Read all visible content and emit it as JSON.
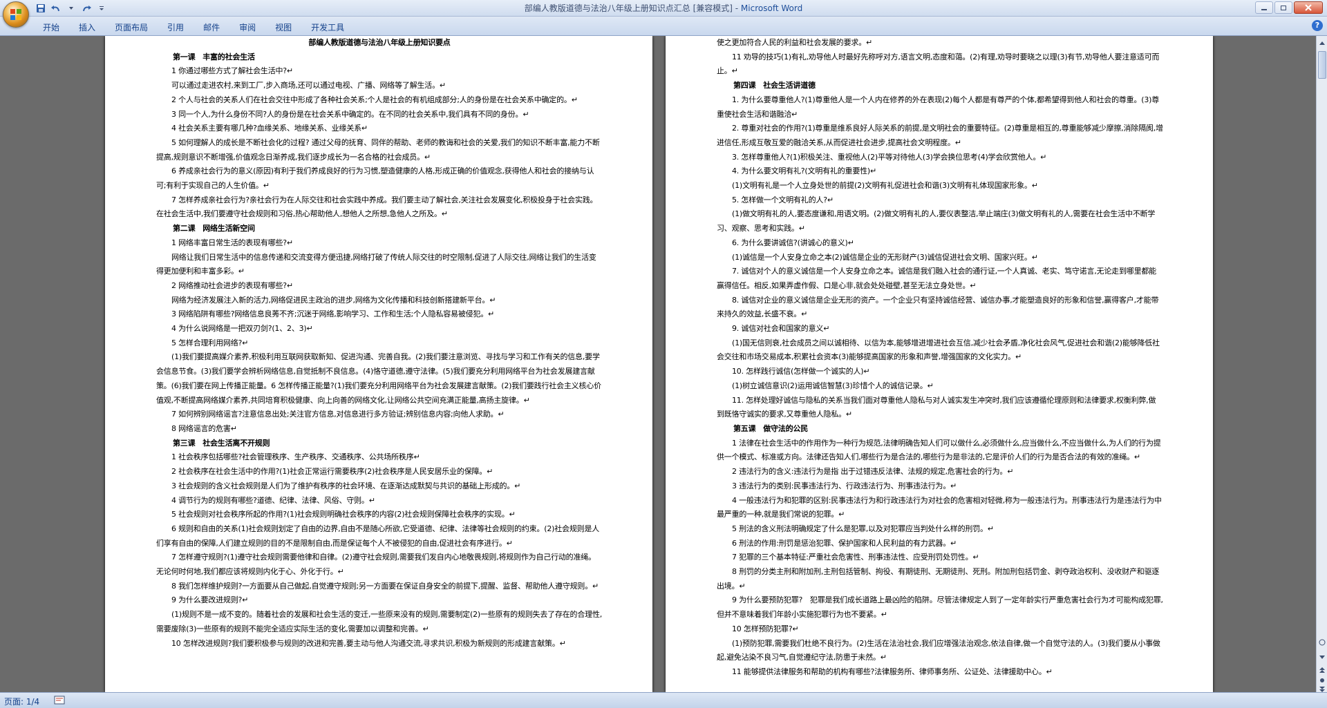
{
  "window": {
    "title_doc": "部编人教版道德与法治八年级上册知识点汇总 [兼容模式] - ",
    "title_app": "Microsoft Word"
  },
  "ribbon": {
    "tabs": [
      "开始",
      "插入",
      "页面布局",
      "引用",
      "邮件",
      "审阅",
      "视图",
      "开发工具"
    ]
  },
  "status": {
    "page": "页面: 1/4"
  },
  "icons": {
    "office": "office-logo-icon",
    "save": "save-icon",
    "undo": "undo-icon",
    "redo": "redo-icon"
  },
  "page1": {
    "lines": [
      {
        "s": "t",
        "text": "部编人教版道德与法治八年级上册知识要点"
      },
      {
        "s": "h",
        "text": "第一课　丰富的社会生活"
      },
      {
        "s": "i",
        "text": "1 你通过哪些方式了解社会生活中?↵"
      },
      {
        "s": "i",
        "text": "可以通过走进农村,来到工厂,步入商场,还可以通过电视、广播、网络等了解生活。↵"
      },
      {
        "s": "i",
        "text": "2 个人与社会的关系人们在社会交往中形成了各种社会关系;个人是社会的有机组成部分;人的身份是在社会关系中确定的。↵"
      },
      {
        "s": "i",
        "text": "3 同一个人,为什么身份不同?人的身份是在社会关系中确定的。在不同的社会关系中,我们具有不同的身份。↵"
      },
      {
        "s": "i",
        "text": "4 社会关系主要有哪几种?血缘关系、地缘关系、业缘关系↵"
      },
      {
        "s": "i",
        "text": "5 如何理解人的成长是不断社会化的过程? 通过父母的抚育、同伴的帮助、老师的教诲和社会的关爱,我们的知识不断丰富,能力不断提高,规则意识不断增强,价值观念日渐养成,我们逐步成长为一名合格的社会成员。↵"
      },
      {
        "s": "i",
        "text": "6 养成亲社会行为的意义(原因)有利于我们养成良好的行为习惯,塑造健康的人格,形成正确的价值观念,获得他人和社会的接纳与认可;有利于实现自己的人生价值。↵"
      },
      {
        "s": "i",
        "text": "7 怎样养成亲社会行为?亲社会行为在人际交往和社会实践中养成。我们要主动了解社会,关注社会发展变化,积极投身于社会实践。在社会生活中,我们要遵守社会规则和习俗,热心帮助他人,想他人之所想,急他人之所及。↵"
      },
      {
        "s": "h",
        "text": "第二课　网络生活新空间"
      },
      {
        "s": "i",
        "text": "1 网络丰富日常生活的表现有哪些?↵"
      },
      {
        "s": "i",
        "text": "网络让我们日常生活中的信息传递和交流变得方便迅捷,网络打破了传统人际交往的时空限制,促进了人际交往,网络让我们的生活变得更加便利和丰富多彩。↵"
      },
      {
        "s": "i",
        "text": "2 网络推动社会进步的表现有哪些?↵"
      },
      {
        "s": "i",
        "text": "网络为经济发展注入新的活力,网络促进民主政治的进步,网络为文化传播和科技创新搭建新平台。↵"
      },
      {
        "s": "i",
        "text": "3 网络陷阱有哪些?网络信息良莠不齐;沉迷于网络,影响学习、工作和生活;个人隐私容易被侵犯。↵"
      },
      {
        "s": "i",
        "text": "4 为什么说网络是一把双刃剑?(1、2、3)↵"
      },
      {
        "s": "i",
        "text": "5 怎样合理利用网络?↵"
      },
      {
        "s": "i",
        "text": "(1)我们要提高媒介素养,积极利用互联网获取新知、促进沟通、完善自我。(2)我们要注意浏览、寻找与学习和工作有关的信息,要学会信息节食。(3)我们要学会辨析网络信息,自觉抵制不良信息。(4)恪守道德,遵守法律。(5)我们要充分利用网络平台为社会发展建言献策。(6)我们要在网上传播正能量。6 怎样传播正能量?(1)我们要充分利用网络平台为社会发展建言献策。(2)我们要践行社会主义核心价值观,不断提高网络媒介素养,共同培育积极健康、向上向善的网络文化,让网络公共空间充满正能量,高扬主旋律。↵"
      },
      {
        "s": "i",
        "text": "7 如何辨别网络谣言?注意信息出处;关注官方信息,对信息进行多方验证;辨别信息内容;向他人求助。↵"
      },
      {
        "s": "i",
        "text": "8 网络谣言的危害↵"
      },
      {
        "s": "h",
        "text": "第三课　社会生活离不开规则"
      },
      {
        "s": "i",
        "text": "1 社会秩序包括哪些?社会管理秩序、生产秩序、交通秩序、公共场所秩序↵"
      },
      {
        "s": "i",
        "text": "2 社会秩序在社会生活中的作用?(1)社会正常运行需要秩序(2)社会秩序是人民安居乐业的保障。↵"
      },
      {
        "s": "i",
        "text": "3 社会规则的含义社会规则是人们为了维护有秩序的社会环境、在逐渐达成默契与共识的基础上形成的。↵"
      },
      {
        "s": "i",
        "text": "4 调节行为的规则有哪些?道德、纪律、法律、风俗、守则。↵"
      },
      {
        "s": "i",
        "text": "5 社会规则对社会秩序所起的作用?(1)社会规则明确社会秩序的内容(2)社会规则保障社会秩序的实现。↵"
      },
      {
        "s": "i",
        "text": "6 规则和自由的关系(1)社会规则划定了自由的边界,自由不是随心所欲,它受道德、纪律、法律等社会规则的约束。(2)社会规则是人们享有自由的保障,人们建立规则的目的不是限制自由,而是保证每个人不被侵犯的自由,促进社会有序进行。↵"
      },
      {
        "s": "i",
        "text": "7 怎样遵守规则?(1)遵守社会规则需要他律和自律。(2)遵守社会规则,需要我们发自内心地敬畏规则,将规则作为自己行动的准绳。无论何时何地,我们都应该将规则内化于心、外化于行。↵"
      },
      {
        "s": "i",
        "text": "8 我们怎样维护规则?一方面要从自己做起,自觉遵守规则;另一方面要在保证自身安全的前提下,提醒、监督、帮助他人遵守规则。↵"
      },
      {
        "s": "i",
        "text": "9 为什么要改进规则?↵"
      },
      {
        "s": "i",
        "text": "(1)规则不是一成不变的。随着社会的发展和社会生活的变迁,一些原来没有的规则,需要制定(2)一些原有的规则失去了存在的合理性,需要废除(3)一些原有的规则不能完全适应实际生活的变化,需要加以调整和完善。↵"
      },
      {
        "s": "i",
        "text": "10 怎样改进规则?我们要积极参与规则的改进和完善,要主动与他人沟通交流,寻求共识,积极为新规则的形成建言献策。↵"
      }
    ]
  },
  "page2": {
    "lines": [
      {
        "s": "p",
        "text": "使之更加符合人民的利益和社会发展的要求。↵"
      },
      {
        "s": "i",
        "text": "11 劝导的技巧(1)有礼,劝导他人时最好先称呼对方,语言文明,态度和蔼。(2)有理,劝导时要晓之以理(3)有节,劝导他人要注意适可而止。↵"
      },
      {
        "s": "h",
        "text": "第四课　社会生活讲道德"
      },
      {
        "s": "i",
        "text": "1. 为什么要尊重他人?(1)尊重他人是一个人内在修养的外在表现(2)每个人都是有尊严的个体,都希望得到他人和社会的尊重。(3)尊重使社会生活和谐融洽↵"
      },
      {
        "s": "i",
        "text": "2. 尊重对社会的作用?(1)尊重是维系良好人际关系的前提,是文明社会的重要特征。(2)尊重是相互的,尊重能够减少摩擦,消除隔阂,增进信任,形成互敬互爱的融洽关系,从而促进社会进步,提高社会文明程度。↵"
      },
      {
        "s": "i",
        "text": "3. 怎样尊重他人?(1)积极关注、重视他人(2)平等对待他人(3)学会换位思考(4)学会欣赏他人。↵"
      },
      {
        "s": "i",
        "text": "4. 为什么要文明有礼?(文明有礼的重要性)↵"
      },
      {
        "s": "i",
        "text": "(1)文明有礼是一个人立身处世的前提(2)文明有礼促进社会和谐(3)文明有礼体现国家形象。↵"
      },
      {
        "s": "i",
        "text": "5. 怎样做一个文明有礼的人?↵"
      },
      {
        "s": "i",
        "text": "(1)做文明有礼的人,要态度谦和,用语文明。(2)做文明有礼的人,要仪表整洁,举止端庄(3)做文明有礼的人,需要在社会生活中不断学习、观察、思考和实践。↵"
      },
      {
        "s": "i",
        "text": "6. 为什么要讲诚信?(讲诚心的意义)↵"
      },
      {
        "s": "i",
        "text": "(1)诚信是一个人安身立命之本(2)诚信是企业的无形财产(3)诚信促进社会文明、国家兴旺。↵"
      },
      {
        "s": "i",
        "text": "7. 诚信对个人的意义诚信是一个人安身立命之本。诚信是我们融入社会的通行证,一个人真诚、老实、笃守诺言,无论走到哪里都能赢得信任。相反,如果弄虚作假、口是心非,就会处处碰壁,甚至无法立身处世。↵"
      },
      {
        "s": "i",
        "text": "8. 诚信对企业的意义诚信是企业无形的资产。一个企业只有坚持诚信经营、诚信办事,才能塑造良好的形象和信誉,赢得客户,才能带来持久的效益,长盛不衰。↵"
      },
      {
        "s": "i",
        "text": "9. 诚信对社会和国家的意义↵"
      },
      {
        "s": "i",
        "text": "(1)国无信则衰,社会成员之间以诚相待、以信为本,能够增进增进社会互信,减少社会矛盾,净化社会风气,促进社会和谐(2)能够降低社会交往和市场交易成本,积累社会资本(3)能够提高国家的形象和声誉,增强国家的文化实力。↵"
      },
      {
        "s": "i",
        "text": "10. 怎样践行诚信(怎样做一个诚实的人)↵"
      },
      {
        "s": "i",
        "text": "(1)树立诚信意识(2)运用诚信智慧(3)珍惜个人的诚信记录。↵"
      },
      {
        "s": "i",
        "text": "11. 怎样处理好诚信与隐私的关系当我们面对尊重他人隐私与对人诚实发生冲突时,我们应该遵循伦理原则和法律要求,权衡利弊,做到既恪守诚实的要求,又尊重他人隐私。↵"
      },
      {
        "s": "h",
        "text": "第五课　做守法的公民"
      },
      {
        "s": "i",
        "text": "1 法律在社会生活中的作用作为一种行为规范,法律明确告知人们可以做什么,必须做什么,应当做什么,不应当做什么,为人们的行为提供一个模式、标准或方向。法律还告知人们,哪些行为是合法的,哪些行为是非法的,它是评价人们的行为是否合法的有效的准绳。↵"
      },
      {
        "s": "i",
        "text": "2 违法行为的含义:违法行为是指 出于过错违反法律、法规的规定,危害社会的行为。↵"
      },
      {
        "s": "i",
        "text": "3 违法行为的类别:民事违法行为、行政违法行为、刑事违法行为。↵"
      },
      {
        "s": "i",
        "text": "4 一般违法行为和犯罪的区别:民事违法行为和行政违法行为对社会的危害相对轻微,称为一般违法行为。刑事违法行为是违法行为中最严重的一种,就是我们常说的犯罪。↵"
      },
      {
        "s": "i",
        "text": "5 刑法的含义刑法明确规定了什么是犯罪,以及对犯罪应当判处什么样的刑罚。↵"
      },
      {
        "s": "i",
        "text": "6 刑法的作用:刑罚是惩治犯罪、保护国家和人民利益的有力武器。↵"
      },
      {
        "s": "i",
        "text": "7 犯罪的三个基本特征:严重社会危害性、刑事违法性、应受刑罚处罚性。↵"
      },
      {
        "s": "i",
        "text": "8 刑罚的分类主刑和附加刑,主刑包括管制、拘役、有期徒刑、无期徒刑、死刑。附加刑包括罚金、剥夺政治权利、没收财产和驱逐出境。↵"
      },
      {
        "s": "i",
        "text": "9 为什么要预防犯罪?　犯罪是我们成长道路上最凶险的陷阱。尽管法律规定人到了一定年龄实行严重危害社会行为才可能构成犯罪,但并不意味着我们年龄小实施犯罪行为也不要紧。↵"
      },
      {
        "s": "i",
        "text": "10 怎样预防犯罪?↵"
      },
      {
        "s": "i",
        "text": "(1)预防犯罪,需要我们杜绝不良行为。(2)生活在法治社会,我们应增强法治观念,依法自律,做一个自觉守法的人。(3)我们要从小事做起,避免沾染不良习气,自觉遵纪守法,防患于未然。↵"
      },
      {
        "s": "i",
        "text": "11 能够提供法律服务和帮助的机构有哪些?法律服务所、律师事务所、公证处、法律援助中心。↵"
      }
    ]
  }
}
